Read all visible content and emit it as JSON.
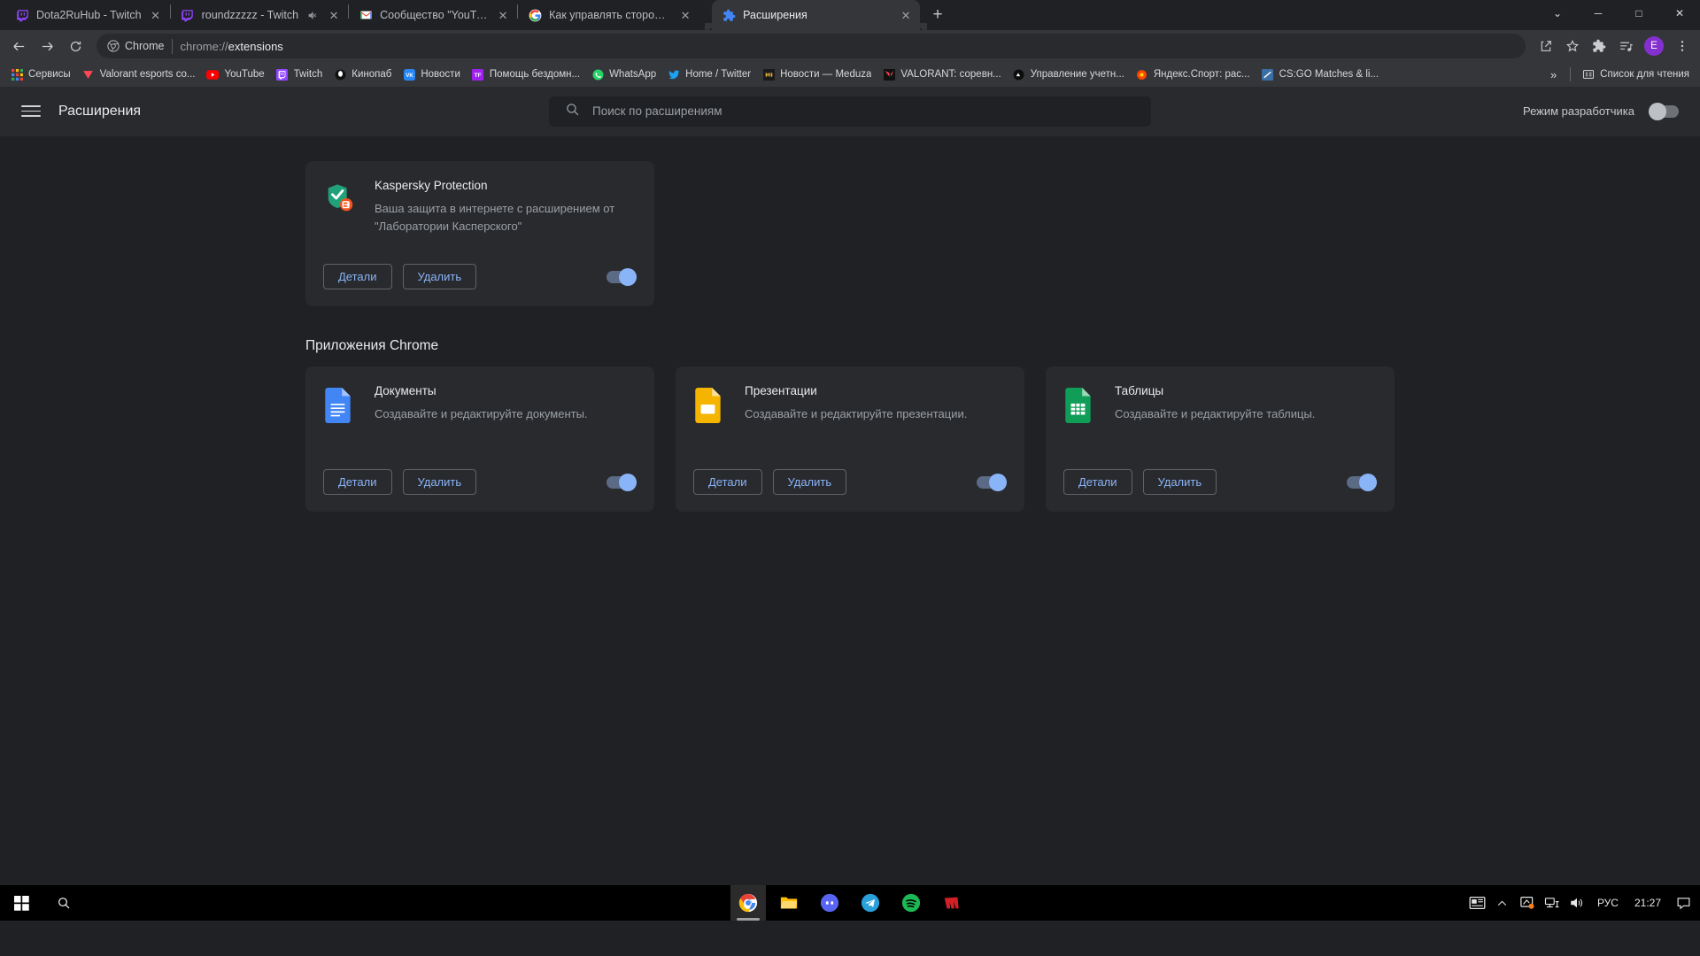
{
  "window": {
    "controls": {
      "minimize": "─",
      "maximize": "□",
      "close": "✕",
      "expand": "⌄"
    }
  },
  "tabs": [
    {
      "title": "Dota2RuHub - Twitch",
      "favicon": "twitch-icon",
      "active": false,
      "muted": false
    },
    {
      "title": "roundzzzzz - Twitch",
      "favicon": "twitch-icon",
      "active": false,
      "muted": true
    },
    {
      "title": "Сообщество \"YouTube\" : \"в исто",
      "favicon": "gmail-icon",
      "active": false,
      "muted": false
    },
    {
      "title": "Как управлять сторонними при",
      "favicon": "google-icon",
      "active": false,
      "muted": false
    },
    {
      "title": "Расширения",
      "favicon": "puzzle-icon",
      "active": true,
      "muted": false
    }
  ],
  "newtab_label": "+",
  "omnibox": {
    "chip_label": "Chrome",
    "url_prefix": "chrome://",
    "url_bold": "extensions",
    "profile_initial": "E"
  },
  "bookmarks": {
    "items": [
      {
        "label": "Сервисы",
        "icon": "apps-grid-icon"
      },
      {
        "label": "Valorant esports co...",
        "icon": "valorant-icon"
      },
      {
        "label": "YouTube",
        "icon": "youtube-icon"
      },
      {
        "label": "Twitch",
        "icon": "twitch-icon"
      },
      {
        "label": "Кинопаб",
        "icon": "kinopub-icon"
      },
      {
        "label": "Новости",
        "icon": "vk-icon"
      },
      {
        "label": "Помощь бездомн...",
        "icon": "tf-icon"
      },
      {
        "label": "WhatsApp",
        "icon": "whatsapp-icon"
      },
      {
        "label": "Home / Twitter",
        "icon": "twitter-icon"
      },
      {
        "label": "Новости — Meduza",
        "icon": "meduza-icon"
      },
      {
        "label": "VALORANT: соревн...",
        "icon": "valorant-v-icon"
      },
      {
        "label": "Управление учетн...",
        "icon": "account-icon"
      },
      {
        "label": "Яндекс.Спорт: рас...",
        "icon": "yandex-sport-icon"
      },
      {
        "label": "CS:GO Matches & li...",
        "icon": "csgo-icon"
      }
    ],
    "overflow": "»",
    "reading_list": "Список для чтения"
  },
  "extensions_page": {
    "title": "Расширения",
    "search_placeholder": "Поиск по расширениям",
    "search_value": "",
    "dev_mode_label": "Режим разработчика",
    "dev_mode_on": false,
    "buttons": {
      "details": "Детали",
      "remove": "Удалить"
    },
    "extensions": [
      {
        "name": "Kaspersky Protection",
        "description": "Ваша защита в интернете с расширением от \"Лаборатории Касперского\"",
        "icon": "kaspersky-shield-icon",
        "enabled": true
      }
    ],
    "apps_section_title": "Приложения Chrome",
    "apps": [
      {
        "name": "Документы",
        "description": "Создавайте и редактируйте документы.",
        "icon": "google-docs-icon",
        "enabled": true
      },
      {
        "name": "Презентации",
        "description": "Создавайте и редактируйте презентации.",
        "icon": "google-slides-icon",
        "enabled": true
      },
      {
        "name": "Таблицы",
        "description": "Создавайте и редактируйте таблицы.",
        "icon": "google-sheets-icon",
        "enabled": true
      }
    ]
  },
  "taskbar": {
    "apps": [
      {
        "name": "chrome-taskbar-icon",
        "running": true
      },
      {
        "name": "file-explorer-taskbar-icon",
        "running": false
      },
      {
        "name": "discord-taskbar-icon",
        "running": false
      },
      {
        "name": "telegram-taskbar-icon",
        "running": false
      },
      {
        "name": "spotify-taskbar-icon",
        "running": false
      },
      {
        "name": "riot-taskbar-icon",
        "running": false
      }
    ],
    "tray": {
      "language": "РУС",
      "clock": "21:27"
    }
  },
  "colors": {
    "accent_blue": "#8ab4f8",
    "surface": "#292a2d",
    "background": "#202124",
    "toolbar": "#35363a",
    "profile_purple": "#8430ce"
  }
}
